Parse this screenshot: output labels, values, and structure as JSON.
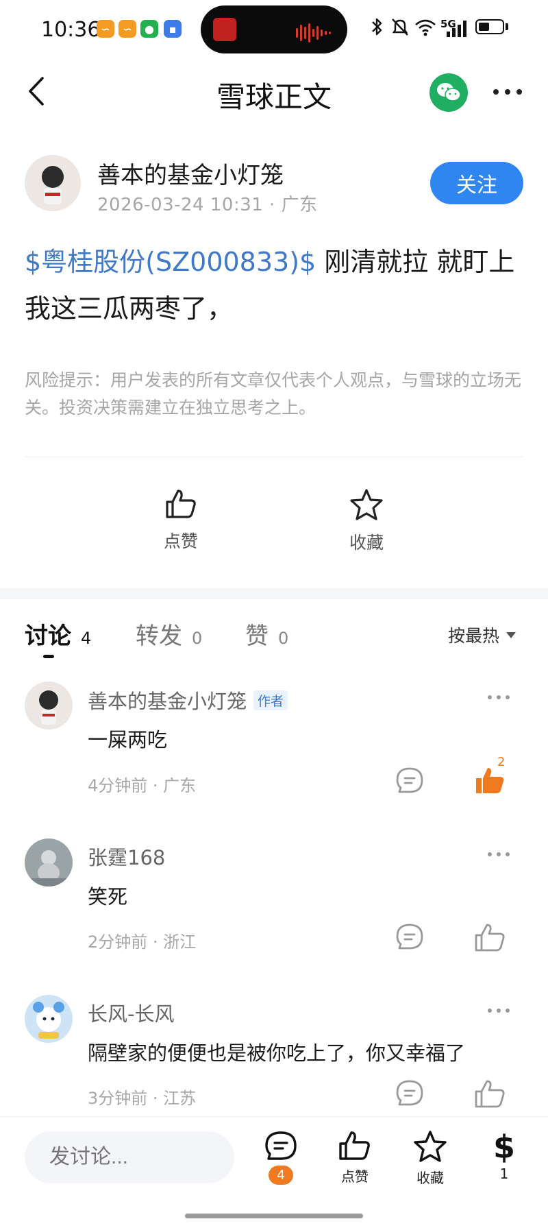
{
  "status_bar": {
    "time": "10:36",
    "icons": [
      "app-orange-icon",
      "app-orange-icon",
      "wechat-icon",
      "app-blue-icon",
      "bluetooth-icon",
      "mute-icon",
      "wifi-icon",
      "signal-5g-icon",
      "battery-icon"
    ],
    "network": "5G"
  },
  "nav": {
    "title": "雪球正文"
  },
  "post": {
    "author_name": "善本的基金小灯笼",
    "meta": "2026-03-24 10:31 · 广东",
    "follow_label": "关注",
    "stock_tag": "$粤桂股份(SZ000833)$",
    "body_text": " 刚清就拉 就盯上我这三瓜两枣了，",
    "risk_notice": "风险提示：用户发表的所有文章仅代表个人观点，与雪球的立场无关。投资决策需建立在独立思考之上。",
    "actions": {
      "like_label": "点赞",
      "favorite_label": "收藏"
    }
  },
  "tabs": [
    {
      "label": "讨论",
      "count": "4",
      "active": true
    },
    {
      "label": "转发",
      "count": "0",
      "active": false
    },
    {
      "label": "赞",
      "count": "0",
      "active": false
    }
  ],
  "sort_label": "按最热",
  "comments": [
    {
      "name": "善本的基金小灯笼",
      "tag": "作者",
      "text": "一屎两吃",
      "meta": "4分钟前 · 广东",
      "likes": "2",
      "liked": true
    },
    {
      "name": "张霆168",
      "tag": "",
      "text": "笑死",
      "meta": "2分钟前 · 浙江",
      "likes": "",
      "liked": false
    },
    {
      "name": "长风-长风",
      "tag": "",
      "text": "隔壁家的便便也是被你吃上了，你又幸福了",
      "meta": "3分钟前 · 江苏",
      "likes": "",
      "liked": false
    }
  ],
  "bottom_bar": {
    "input_placeholder": "发讨论...",
    "comment_badge": "4",
    "like_label": "点赞",
    "favorite_label": "收藏",
    "reward_count": "1"
  },
  "colors": {
    "accent_blue": "#2f86f0",
    "link_blue": "#3f79c8",
    "orange": "#f07a1f",
    "wechat_green": "#1fae62"
  }
}
